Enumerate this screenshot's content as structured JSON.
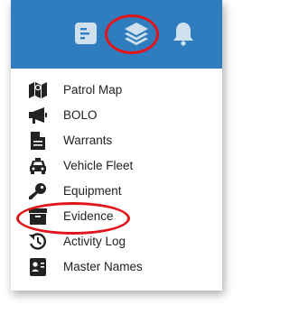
{
  "toolbar": {
    "buttons": [
      {
        "icon": "dashboard-icon"
      },
      {
        "icon": "layers-icon"
      },
      {
        "icon": "bell-icon"
      }
    ],
    "color": "#2f7dbf",
    "icon_color": "#cfe0ef"
  },
  "menu": {
    "items": [
      {
        "label": "Patrol Map",
        "icon": "map-icon"
      },
      {
        "label": "BOLO",
        "icon": "megaphone-icon"
      },
      {
        "label": "Warrants",
        "icon": "document-icon"
      },
      {
        "label": "Vehicle Fleet",
        "icon": "car-icon"
      },
      {
        "label": "Equipment",
        "icon": "key-icon"
      },
      {
        "label": "Evidence",
        "icon": "archive-box-icon"
      },
      {
        "label": "Activity Log",
        "icon": "history-icon"
      },
      {
        "label": "Master Names",
        "icon": "id-card-icon"
      }
    ]
  },
  "annotations": {
    "highlight_color": "#e0161b"
  }
}
